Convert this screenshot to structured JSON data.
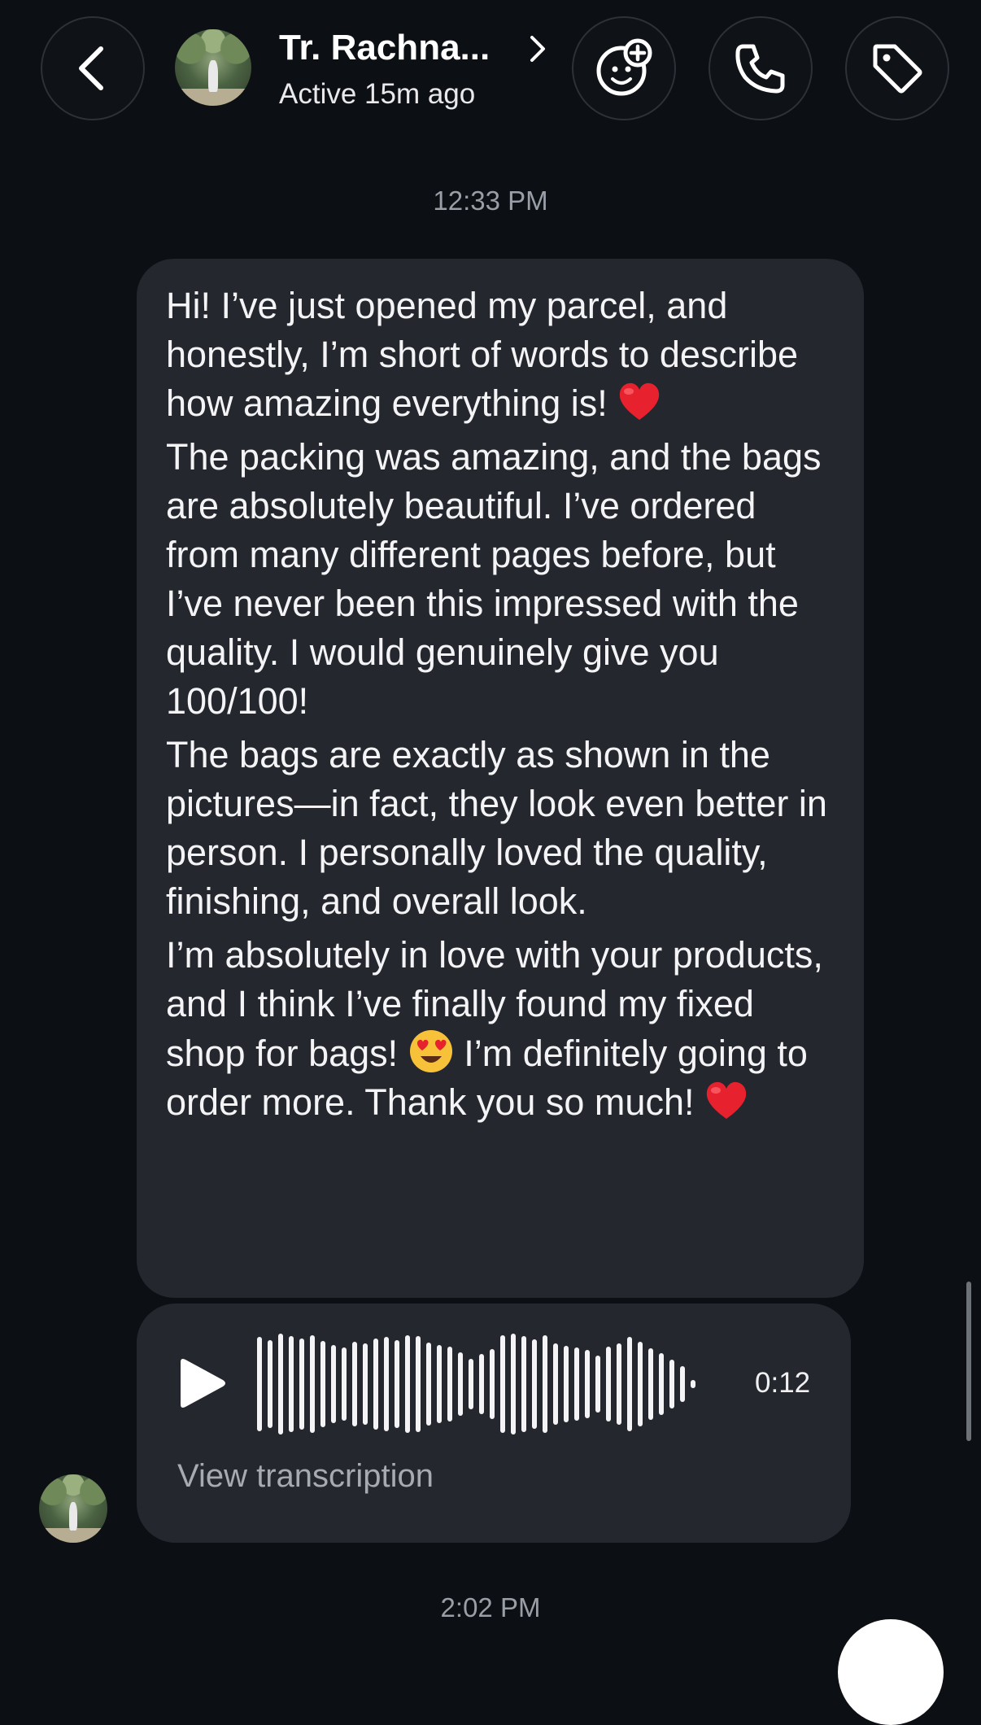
{
  "header": {
    "contact_name": "Tr. Rachna...",
    "status": "Active 15m ago",
    "back_icon": "chevron-left-icon",
    "actions": [
      "add-friend-face-icon",
      "phone-icon",
      "tag-icon"
    ]
  },
  "conversation": {
    "timestamps": [
      "12:33 PM",
      "2:02 PM"
    ],
    "message": {
      "paragraphs": [
        {
          "text": "Hi! I’ve just opened my parcel, and honestly, I’m short of words to describe how amazing everything is!",
          "trailing_emoji": "red-heart"
        },
        {
          "text": "The packing was amazing, and the bags are absolutely beautiful. I’ve ordered from many different pages before, but I’ve never been this impressed with the quality. I would genuinely give you 100/100!"
        },
        {
          "text": "The bags are exactly as shown in the pictures—in fact, they look even better in person. I personally loved the quality, finishing, and overall look."
        },
        {
          "text_before_emoji": "I’m absolutely in love with your products, and I think I’ve finally found my fixed shop for bags!",
          "emoji": "heart-eyes-face",
          "text_after_emoji": " I’m definitely going to order more. Thank you so much!",
          "trailing_emoji": "red-heart"
        }
      ]
    },
    "voice_message": {
      "duration": "0:12",
      "transcription_label": "View transcription",
      "play_icon": "play-icon"
    }
  },
  "colors": {
    "background": "#0c0f14",
    "bubble": "#24272d",
    "text": "#f4f4f6",
    "muted": "#9a9ea6",
    "heart": "#e8212e",
    "emoji_face": "#f7c23a"
  }
}
